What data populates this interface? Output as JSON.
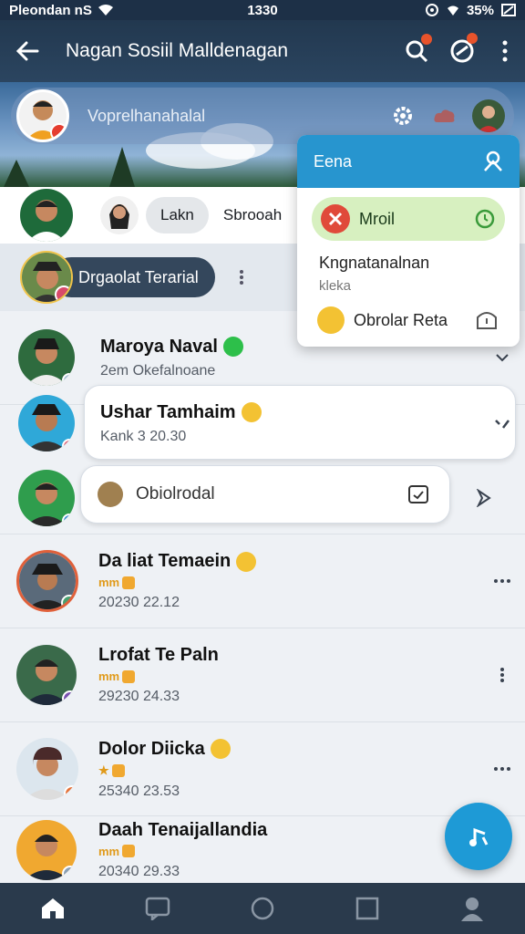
{
  "status_bar": {
    "carrier": "Pleondan nS",
    "time": "1330",
    "battery": "35%"
  },
  "header": {
    "title": "Nagan Sosiil Malldenagan"
  },
  "search": {
    "placeholder": "Voprelhanahalal"
  },
  "filters": {
    "chip_1": "Lakn",
    "chip_2": "Sbrooah"
  },
  "pinned": {
    "label": "Drgaolat Terarial"
  },
  "popup": {
    "title": "Eena",
    "pill_label": "Mroil",
    "line_1": "Kngnatanalnan",
    "line_2": "kleka",
    "option_label": "Obrolar Reta"
  },
  "chats": [
    {
      "name": "Maroya Naval",
      "sub": "2em Okefalnoane"
    },
    {
      "name": "Ushar Tamhaim",
      "sub": "Kank 3 20.30"
    },
    {
      "name": "",
      "bubble": "Obiolrodal"
    },
    {
      "name": "Da liat Temaein",
      "tag": "mm",
      "sub": "20230 22.12"
    },
    {
      "name": "Lrofat Te Paln",
      "tag": "mm",
      "sub": "29230 24.33"
    },
    {
      "name": "Dolor Diicka",
      "tag": "★",
      "sub": "25340 23.53"
    },
    {
      "name": "Daah Tenaijallandia",
      "tag": "mm",
      "sub": "20340 29.33"
    }
  ],
  "colors": {
    "header": "#22384f",
    "accent": "#1e9ad6",
    "popup_head": "#2795cf",
    "nav": "#2a3a4c"
  },
  "icons": [
    "back-arrow-icon",
    "search-icon",
    "notification-icon",
    "more-vert-icon",
    "settings-icon",
    "home-icon",
    "chat-icon",
    "circle-icon",
    "square-icon",
    "profile-icon"
  ]
}
